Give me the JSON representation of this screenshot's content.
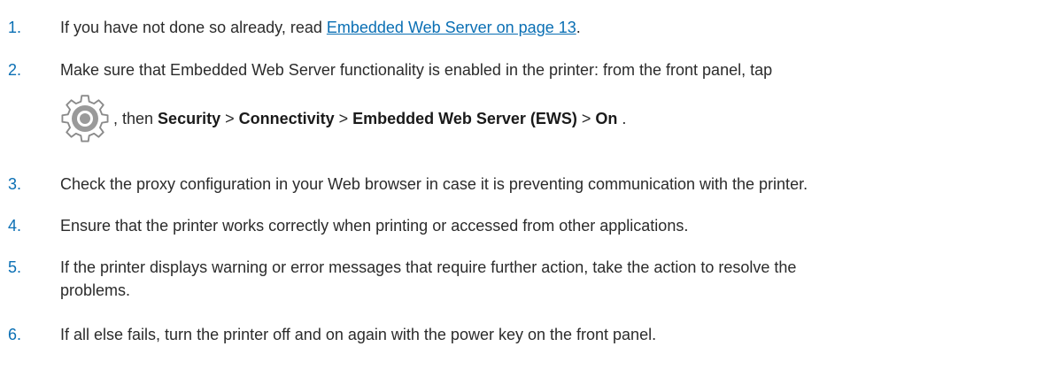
{
  "steps": [
    {
      "number": "1.",
      "before": "If you have not done so already, read ",
      "link": "Embedded Web Server on page 13",
      "after": "."
    },
    {
      "number": "2.",
      "line1": "Make sure that Embedded Web Server functionality is enabled in the printer: from the front panel, tap",
      "icon": "settings-gear-icon",
      "then": ", then ",
      "path": [
        "Security",
        "Connectivity",
        "Embedded Web Server (EWS)",
        "On"
      ],
      "separator": " > ",
      "end": " ."
    },
    {
      "number": "3.",
      "text": "Check the proxy configuration in your Web browser in case it is preventing communication with the printer."
    },
    {
      "number": "4.",
      "text": "Ensure that the printer works correctly when printing or accessed from other applications."
    },
    {
      "number": "5.",
      "text": "If the printer displays warning or error messages that require further action, take the action to resolve the",
      "text2": "problems."
    },
    {
      "number": "6.",
      "text": "If all else fails, turn the printer off and on again with the power key on the front panel."
    }
  ],
  "colors": {
    "accent": "#0a6fb4",
    "text": "#2b2b2b",
    "icon_gray": "#8a8a8a"
  }
}
